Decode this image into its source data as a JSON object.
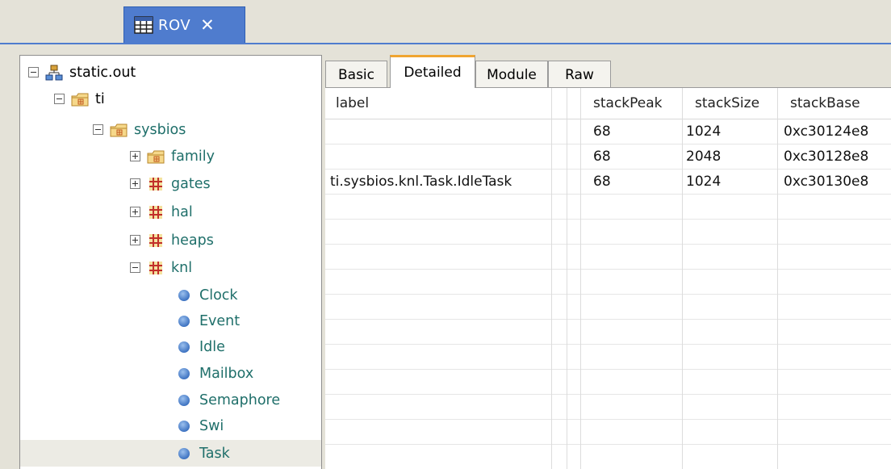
{
  "view_tab": {
    "label": "ROV",
    "close": "✕"
  },
  "tree": [
    {
      "label": "static.out",
      "level": 0,
      "toggle": "minus",
      "icon": "program-icon",
      "kind": "root"
    },
    {
      "label": "ti",
      "level": 1,
      "toggle": "minus",
      "icon": "package-icon",
      "kind": "root"
    },
    {
      "label": "sysbios",
      "level": 2,
      "toggle": "minus",
      "icon": "package-icon",
      "kind": "pkg"
    },
    {
      "label": "family",
      "level": 3,
      "toggle": "plus",
      "icon": "package-icon",
      "kind": "pkg"
    },
    {
      "label": "gates",
      "level": 3,
      "toggle": "plus",
      "icon": "module-grid-icon",
      "kind": "pkg"
    },
    {
      "label": "hal",
      "level": 3,
      "toggle": "plus",
      "icon": "module-grid-icon",
      "kind": "pkg"
    },
    {
      "label": "heaps",
      "level": 3,
      "toggle": "plus",
      "icon": "module-grid-icon",
      "kind": "pkg"
    },
    {
      "label": "knl",
      "level": 3,
      "toggle": "minus",
      "icon": "module-grid-icon",
      "kind": "pkg"
    },
    {
      "label": "Clock",
      "level": 4,
      "icon": "module-ball-icon",
      "kind": "mod"
    },
    {
      "label": "Event",
      "level": 4,
      "icon": "module-ball-icon",
      "kind": "mod"
    },
    {
      "label": "Idle",
      "level": 4,
      "icon": "module-ball-icon",
      "kind": "mod"
    },
    {
      "label": "Mailbox",
      "level": 4,
      "icon": "module-ball-icon",
      "kind": "mod"
    },
    {
      "label": "Semaphore",
      "level": 4,
      "icon": "module-ball-icon",
      "kind": "mod"
    },
    {
      "label": "Swi",
      "level": 4,
      "icon": "module-ball-icon",
      "kind": "mod"
    },
    {
      "label": "Task",
      "level": 4,
      "icon": "module-ball-icon",
      "kind": "mod",
      "selected": true
    }
  ],
  "tabs": [
    "Basic",
    "Detailed",
    "Module",
    "Raw"
  ],
  "active_tab": "Detailed",
  "table": {
    "columns": [
      "label",
      "",
      "",
      "stackPeak",
      "stackSize",
      "stackBase"
    ],
    "rows": [
      [
        "",
        "",
        "",
        "68",
        "1024",
        "0xc30124e8"
      ],
      [
        "",
        "",
        "",
        "68",
        "2048",
        "0xc30128e8"
      ],
      [
        "ti.sysbios.knl.Task.IdleTask",
        "",
        "",
        "68",
        "1024",
        "0xc30130e8"
      ]
    ]
  },
  "colors": {
    "view_tab_bg": "#4f7cce",
    "active_tab_accent": "#f0a531",
    "tree_label_teal": "#1f6f6a",
    "selected_row_bg": "#ecebe4"
  }
}
